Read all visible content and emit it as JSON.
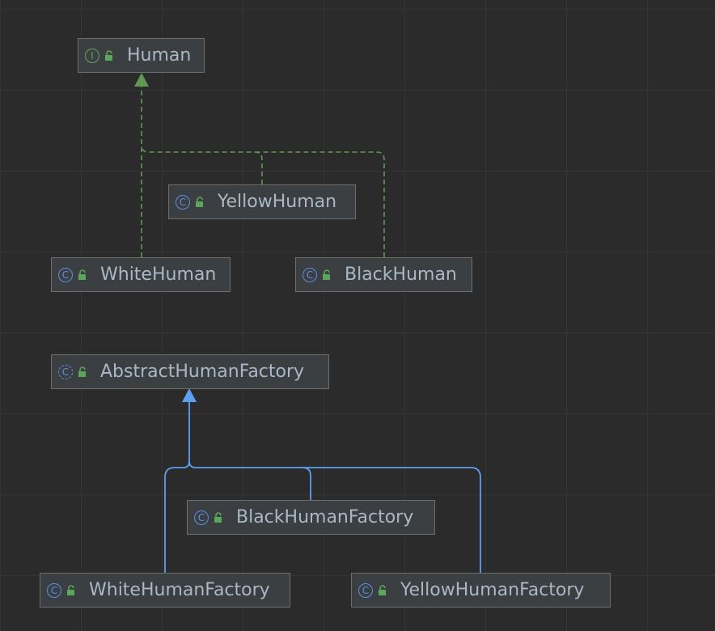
{
  "nodes": {
    "human": {
      "label": "Human",
      "kind": "interface",
      "kind_glyph": "I",
      "icon": "interface-icon"
    },
    "yellow_human": {
      "label": "YellowHuman",
      "kind": "class",
      "kind_glyph": "C",
      "icon": "class-icon"
    },
    "white_human": {
      "label": "WhiteHuman",
      "kind": "class",
      "kind_glyph": "C",
      "icon": "class-icon"
    },
    "black_human": {
      "label": "BlackHuman",
      "kind": "class",
      "kind_glyph": "C",
      "icon": "class-icon"
    },
    "abstract_human_factory": {
      "label": "AbstractHumanFactory",
      "kind": "abstract-class",
      "kind_glyph": "C",
      "icon": "abstract-class-icon"
    },
    "black_human_factory": {
      "label": "BlackHumanFactory",
      "kind": "class",
      "kind_glyph": "C",
      "icon": "class-icon"
    },
    "white_human_factory": {
      "label": "WhiteHumanFactory",
      "kind": "class",
      "kind_glyph": "C",
      "icon": "class-icon"
    },
    "yellow_human_factory": {
      "label": "YellowHumanFactory",
      "kind": "class",
      "kind_glyph": "C",
      "icon": "class-icon"
    }
  },
  "edges": [
    {
      "from": "white_human",
      "to": "human",
      "type": "implements"
    },
    {
      "from": "yellow_human",
      "to": "human",
      "type": "implements"
    },
    {
      "from": "black_human",
      "to": "human",
      "type": "implements"
    },
    {
      "from": "white_human_factory",
      "to": "abstract_human_factory",
      "type": "extends"
    },
    {
      "from": "black_human_factory",
      "to": "abstract_human_factory",
      "type": "extends"
    },
    {
      "from": "yellow_human_factory",
      "to": "abstract_human_factory",
      "type": "extends"
    }
  ],
  "colors": {
    "background": "#2b2b2b",
    "grid": "#353535",
    "node_fill": "#3c3f41",
    "node_border": "#6e6e6e",
    "text": "#a9b7c6",
    "implements_edge": "#629755",
    "extends_edge": "#5f9ff0",
    "class_icon": "#5b8ee6",
    "interface_icon": "#5aa65a",
    "lock_icon": "#5aa65a"
  }
}
